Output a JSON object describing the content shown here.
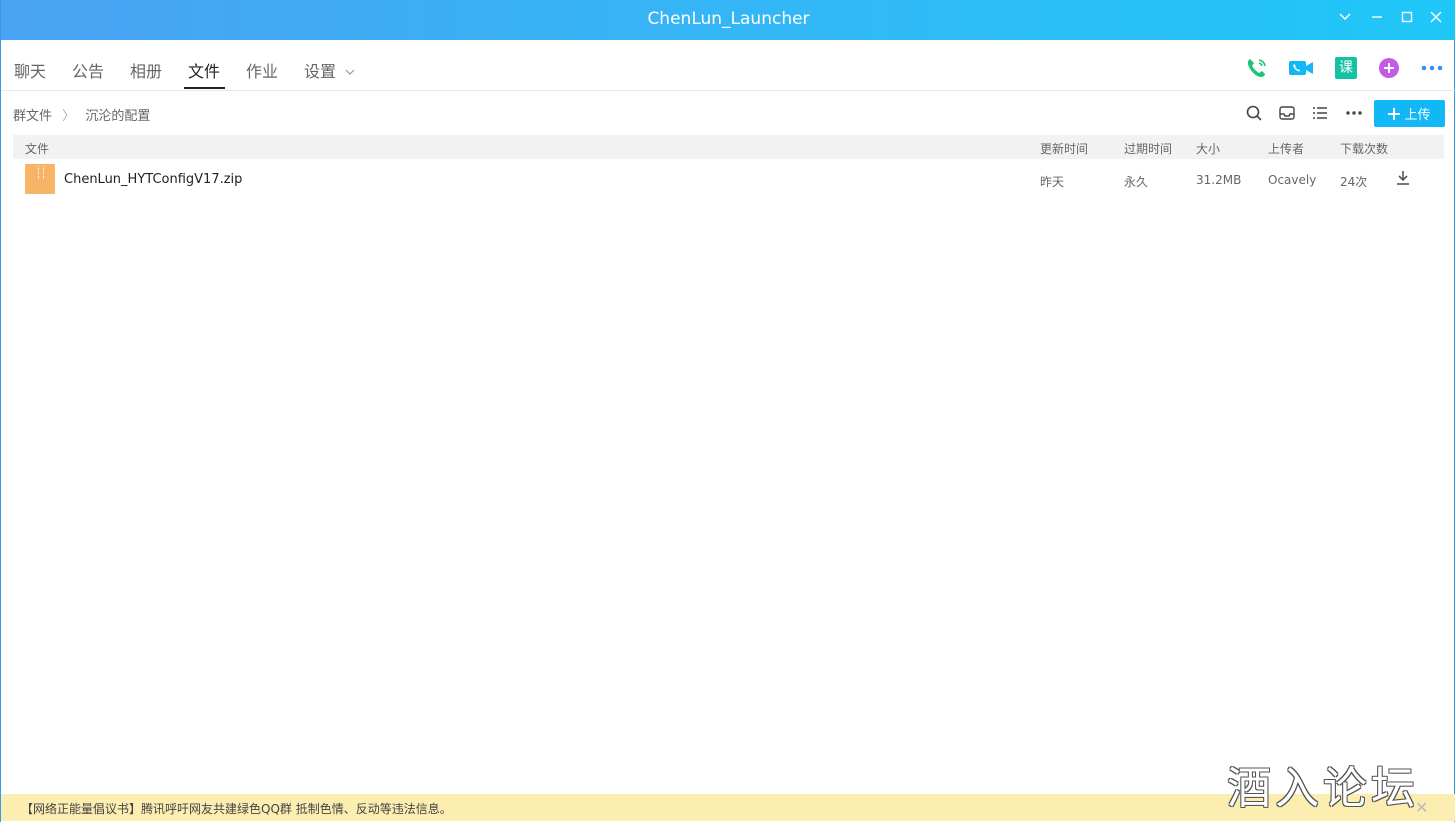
{
  "window": {
    "title": "ChenLun_Launcher"
  },
  "nav": {
    "tabs": [
      {
        "label": "聊天"
      },
      {
        "label": "公告"
      },
      {
        "label": "相册"
      },
      {
        "label": "文件"
      },
      {
        "label": "作业"
      },
      {
        "label": "设置"
      }
    ],
    "active_tab": "文件",
    "icons": [
      "phone-call-icon",
      "video-call-icon",
      "course-icon",
      "add-app-icon",
      "more-icon"
    ],
    "course_icon_text": "课"
  },
  "breadcrumb": {
    "root": "群文件",
    "current": "沉沦的配置"
  },
  "toolbar": {
    "upload_label": "上传"
  },
  "table": {
    "headers": {
      "file": "文件",
      "updated": "更新时间",
      "expires": "过期时间",
      "size": "大小",
      "uploader": "上传者",
      "downloads": "下载次数"
    },
    "rows": [
      {
        "name": "ChenLun_HYTConfigV17.zip",
        "updated": "昨天",
        "expires": "永久",
        "size": "31.2MB",
        "uploader": "Ocavely",
        "downloads": "24次"
      }
    ]
  },
  "notice": {
    "text": "【网络正能量倡议书】腾讯呼吁网友共建绿色QQ群 抵制色情、反动等违法信息。"
  },
  "watermark": {
    "text": "酒入论坛"
  },
  "colors": {
    "titlebar_start": "#4aa2f3",
    "titlebar_end": "#1fc7f7",
    "upload": "#12b7f5",
    "notice_bg": "#fcedb1",
    "file_icon": "#f7b366"
  }
}
